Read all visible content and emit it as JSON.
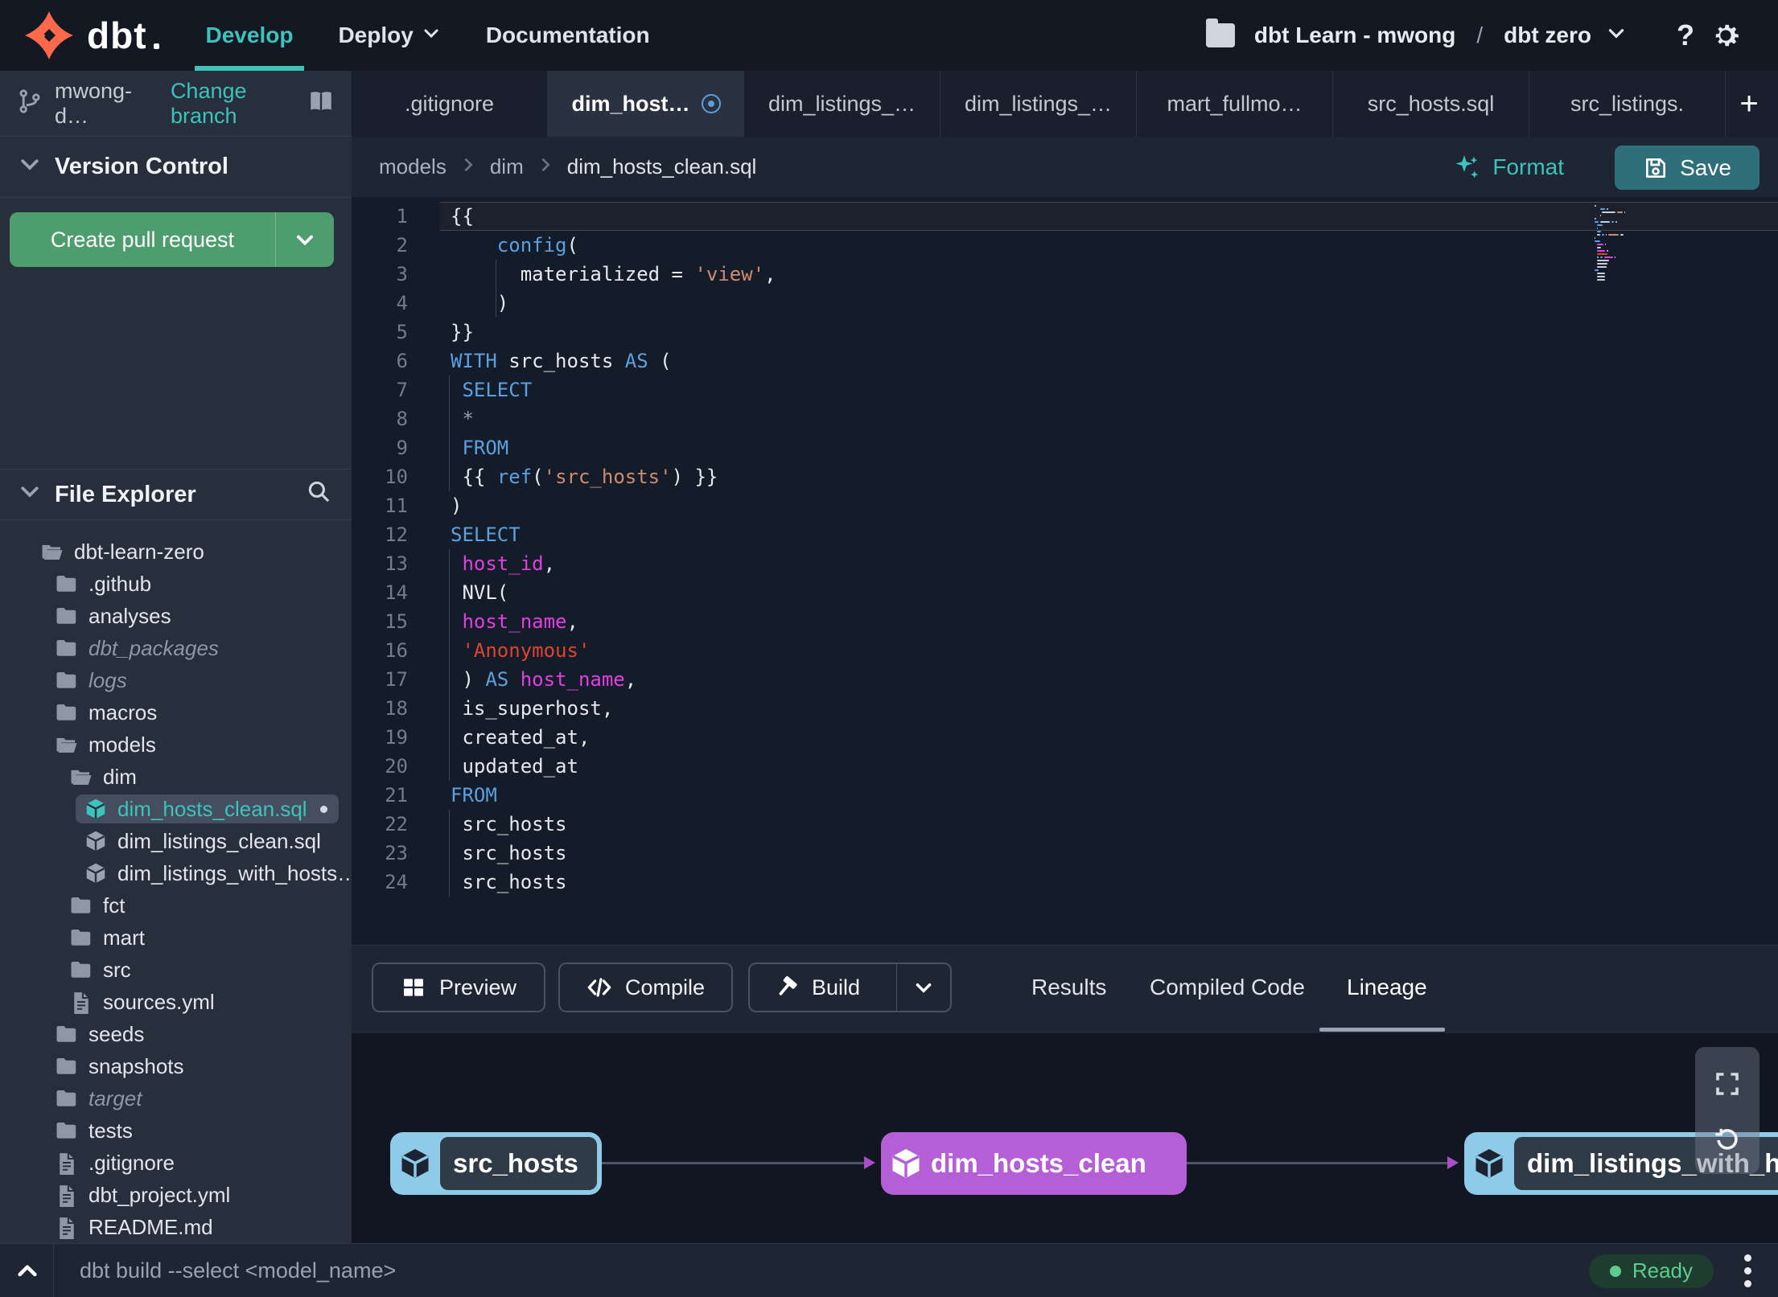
{
  "colors": {
    "teal": "#3dc2bc",
    "orange": "#ff694b",
    "green": "#4e9d6e",
    "save_teal": "#2f6f7a",
    "purple": "#b55fd6",
    "node_blue": "#8ecbe8",
    "ready_green": "#5ecb8f"
  },
  "nav": {
    "brand": "dbt",
    "items": [
      {
        "label": "Develop",
        "active": true
      },
      {
        "label": "Deploy",
        "chevron": true
      },
      {
        "label": "Documentation"
      }
    ],
    "project": {
      "account": "dbt Learn - mwong",
      "separator": "/",
      "name": "dbt zero"
    },
    "help_label": "?"
  },
  "sidebar": {
    "branch": {
      "name": "mwong-d…",
      "action": "Change branch"
    },
    "version_control": {
      "title": "Version Control",
      "button_label": "Create pull request"
    },
    "file_explorer": {
      "title": "File Explorer",
      "items": [
        {
          "label": "dbt-learn-zero",
          "level": 0,
          "type": "folder-open"
        },
        {
          "label": ".github",
          "level": 1,
          "type": "folder"
        },
        {
          "label": "analyses",
          "level": 1,
          "type": "folder"
        },
        {
          "label": "dbt_packages",
          "level": 1,
          "type": "folder",
          "italic": true
        },
        {
          "label": "logs",
          "level": 1,
          "type": "folder",
          "italic": true
        },
        {
          "label": "macros",
          "level": 1,
          "type": "folder"
        },
        {
          "label": "models",
          "level": 1,
          "type": "folder-open"
        },
        {
          "label": "dim",
          "level": 2,
          "type": "folder-open"
        },
        {
          "label": "dim_hosts_clean.sql",
          "level": 3,
          "type": "model",
          "selected": true,
          "modified": true
        },
        {
          "label": "dim_listings_clean.sql",
          "level": 3,
          "type": "model"
        },
        {
          "label": "dim_listings_with_hosts…",
          "level": 3,
          "type": "model"
        },
        {
          "label": "fct",
          "level": 2,
          "type": "folder"
        },
        {
          "label": "mart",
          "level": 2,
          "type": "folder"
        },
        {
          "label": "src",
          "level": 2,
          "type": "folder"
        },
        {
          "label": "sources.yml",
          "level": 2,
          "type": "file"
        },
        {
          "label": "seeds",
          "level": 1,
          "type": "folder"
        },
        {
          "label": "snapshots",
          "level": 1,
          "type": "folder"
        },
        {
          "label": "target",
          "level": 1,
          "type": "folder",
          "italic": true
        },
        {
          "label": "tests",
          "level": 1,
          "type": "folder"
        },
        {
          "label": ".gitignore",
          "level": 1,
          "type": "file"
        },
        {
          "label": "dbt_project.yml",
          "level": 1,
          "type": "file"
        },
        {
          "label": "README.md",
          "level": 1,
          "type": "file"
        }
      ]
    }
  },
  "tabs": {
    "add_label": "+",
    "items": [
      {
        "label": ".gitignore"
      },
      {
        "label": "dim_host…",
        "active": true,
        "modified": true
      },
      {
        "label": "dim_listings_…"
      },
      {
        "label": "dim_listings_…"
      },
      {
        "label": "mart_fullmo…"
      },
      {
        "label": "src_hosts.sql"
      },
      {
        "label": "src_listings."
      }
    ]
  },
  "editor": {
    "breadcrumb": [
      "models",
      "dim",
      "dim_hosts_clean.sql"
    ],
    "format_label": "Format",
    "save_label": "Save",
    "code": {
      "lines": [
        {
          "n": 1,
          "g": -1,
          "active": true,
          "t": [
            [
              "id",
              "{{"
            ]
          ]
        },
        {
          "n": 2,
          "g": -1,
          "t": [
            [
              "ws",
              "    "
            ],
            [
              "kw",
              "config"
            ],
            [
              "id",
              "("
            ]
          ]
        },
        {
          "n": 3,
          "g": 4,
          "t": [
            [
              "ws",
              "      "
            ],
            [
              "id",
              "materialized = "
            ],
            [
              "str",
              "'view'"
            ],
            [
              "id",
              ","
            ]
          ]
        },
        {
          "n": 4,
          "g": 4,
          "t": [
            [
              "ws",
              "    "
            ],
            [
              "id",
              ")"
            ]
          ]
        },
        {
          "n": 5,
          "g": -1,
          "t": [
            [
              "id",
              "}}"
            ]
          ]
        },
        {
          "n": 6,
          "g": -1,
          "t": [
            [
              "kw",
              "WITH"
            ],
            [
              "id",
              " src_hosts "
            ],
            [
              "kw",
              "AS"
            ],
            [
              "id",
              " ("
            ]
          ]
        },
        {
          "n": 7,
          "g": 0,
          "t": [
            [
              "ws",
              " "
            ],
            [
              "kw",
              "SELECT"
            ]
          ]
        },
        {
          "n": 8,
          "g": 0,
          "t": [
            [
              "ws",
              " "
            ],
            [
              "op",
              "*"
            ]
          ]
        },
        {
          "n": 9,
          "g": 0,
          "t": [
            [
              "ws",
              " "
            ],
            [
              "kw",
              "FROM"
            ]
          ]
        },
        {
          "n": 10,
          "g": 0,
          "t": [
            [
              "ws",
              " "
            ],
            [
              "id",
              "{{ "
            ],
            [
              "kw",
              "ref"
            ],
            [
              "id",
              "("
            ],
            [
              "str",
              "'src_hosts'"
            ],
            [
              "id",
              ") }}"
            ]
          ]
        },
        {
          "n": 11,
          "g": -1,
          "t": [
            [
              "id",
              ")"
            ]
          ]
        },
        {
          "n": 12,
          "g": -1,
          "t": [
            [
              "kw",
              "SELECT"
            ]
          ]
        },
        {
          "n": 13,
          "g": 0,
          "t": [
            [
              "ws",
              " "
            ],
            [
              "col",
              "host_id"
            ],
            [
              "id",
              ","
            ]
          ]
        },
        {
          "n": 14,
          "g": 0,
          "t": [
            [
              "ws",
              " "
            ],
            [
              "id",
              "NVL("
            ]
          ]
        },
        {
          "n": 15,
          "g": 0,
          "t": [
            [
              "ws",
              " "
            ],
            [
              "col",
              "host_name"
            ],
            [
              "id",
              ","
            ]
          ]
        },
        {
          "n": 16,
          "g": 0,
          "t": [
            [
              "ws",
              " "
            ],
            [
              "str2",
              "'Anonymous'"
            ]
          ]
        },
        {
          "n": 17,
          "g": 0,
          "t": [
            [
              "ws",
              " "
            ],
            [
              "id",
              ") "
            ],
            [
              "kw",
              "AS"
            ],
            [
              "col",
              " host_name"
            ],
            [
              "id",
              ","
            ]
          ]
        },
        {
          "n": 18,
          "g": 0,
          "t": [
            [
              "ws",
              " "
            ],
            [
              "id",
              "is_superhost,"
            ]
          ]
        },
        {
          "n": 19,
          "g": 0,
          "t": [
            [
              "ws",
              " "
            ],
            [
              "id",
              "created_at,"
            ]
          ]
        },
        {
          "n": 20,
          "g": 0,
          "t": [
            [
              "ws",
              " "
            ],
            [
              "id",
              "updated_at"
            ]
          ]
        },
        {
          "n": 21,
          "g": -1,
          "t": [
            [
              "kw",
              "FROM"
            ]
          ]
        },
        {
          "n": 22,
          "g": 0,
          "t": [
            [
              "ws",
              " "
            ],
            [
              "id",
              "src_hosts"
            ]
          ]
        },
        {
          "n": 23,
          "g": 0,
          "t": [
            [
              "ws",
              " "
            ],
            [
              "id",
              "src_hosts"
            ]
          ]
        },
        {
          "n": 24,
          "g": 0,
          "t": [
            [
              "ws",
              " "
            ],
            [
              "id",
              "src_hosts"
            ]
          ]
        }
      ]
    }
  },
  "toolbar": {
    "buttons": [
      {
        "label": "Preview",
        "icon": "grid"
      },
      {
        "label": "Compile",
        "icon": "code"
      },
      {
        "label": "Build",
        "icon": "hammer",
        "split": true
      }
    ],
    "tabs": [
      {
        "label": "Results"
      },
      {
        "label": "Compiled Code"
      },
      {
        "label": "Lineage",
        "active": true
      }
    ]
  },
  "lineage": {
    "nodes": [
      {
        "label": "src_hosts",
        "style": "source"
      },
      {
        "label": "dim_hosts_clean",
        "style": "model"
      },
      {
        "label": "dim_listings_with_hosts",
        "style": "source"
      }
    ]
  },
  "statusbar": {
    "command": "dbt build --select <model_name>",
    "status": "Ready"
  }
}
